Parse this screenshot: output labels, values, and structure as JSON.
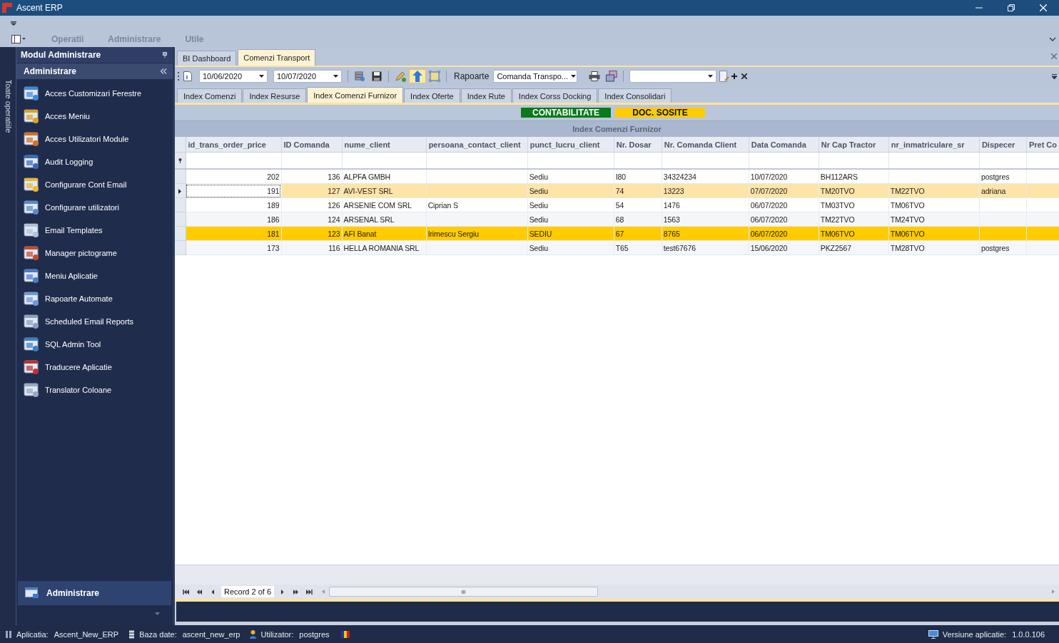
{
  "window": {
    "title": "Ascent ERP"
  },
  "menu": [
    {
      "label": "Operatii"
    },
    {
      "label": "Administrare"
    },
    {
      "label": "Utile"
    }
  ],
  "side_strip": {
    "label": "Toate operatiile"
  },
  "sidebar": {
    "title": "Modul Administrare",
    "group": "Administrare",
    "items": [
      {
        "label": "Acces Customizari Ferestre"
      },
      {
        "label": "Acces Meniu"
      },
      {
        "label": "Acces Utilizatori Module"
      },
      {
        "label": "Audit Logging"
      },
      {
        "label": "Configurare Cont Email"
      },
      {
        "label": "Configurare utilizatori"
      },
      {
        "label": "Email Templates"
      },
      {
        "label": "Manager pictograme"
      },
      {
        "label": "Meniu Aplicatie"
      },
      {
        "label": "Rapoarte Automate"
      },
      {
        "label": "Scheduled Email Reports"
      },
      {
        "label": "SQL Admin Tool"
      },
      {
        "label": "Traducere Aplicatie"
      },
      {
        "label": "Translator Coloane"
      }
    ],
    "footer_group": "Administrare"
  },
  "doc_tabs": [
    {
      "label": "BI Dashboard",
      "selected": false
    },
    {
      "label": "Comenzi Transport",
      "selected": true
    }
  ],
  "toolbar": {
    "date_from": "10/06/2020",
    "date_to": "10/07/2020",
    "reports_label": "Rapoarte",
    "report": "Comanda Transpo..."
  },
  "sub_tabs": [
    {
      "label": "Index Comenzi",
      "selected": false
    },
    {
      "label": "Index Resurse",
      "selected": false
    },
    {
      "label": "Index Comenzi Furnizor",
      "selected": true
    },
    {
      "label": "Index Oferte",
      "selected": false
    },
    {
      "label": "Index Rute",
      "selected": false
    },
    {
      "label": "Index Corss Docking",
      "selected": false
    },
    {
      "label": "Index Consolidari",
      "selected": false
    }
  ],
  "badges": [
    {
      "label": "CONTABILITATE",
      "color": "#0b7a1c"
    },
    {
      "label": "DOC. SOSITE",
      "color": "#ffcc00"
    }
  ],
  "grid": {
    "title": "Index Comenzi Furnizor",
    "columns": [
      {
        "label": "id_trans_order_price",
        "kind": "number"
      },
      {
        "label": "ID Comanda",
        "kind": "number"
      },
      {
        "label": "nume_client",
        "kind": "text"
      },
      {
        "label": "persoana_contact_client",
        "kind": "text"
      },
      {
        "label": "punct_lucru_client",
        "kind": "text"
      },
      {
        "label": "Nr. Dosar",
        "kind": "text"
      },
      {
        "label": "Nr. Comanda Client",
        "kind": "text"
      },
      {
        "label": "Data Comanda",
        "kind": "text"
      },
      {
        "label": "Nr Cap Tractor",
        "kind": "text"
      },
      {
        "label": "nr_inmatriculare_sr",
        "kind": "text"
      },
      {
        "label": "Dispecer",
        "kind": "text"
      },
      {
        "label": "Pret Co",
        "kind": "text"
      }
    ],
    "rows": [
      {
        "cells": [
          "202",
          "136",
          "ALPFA GMBH",
          null,
          "Sediu",
          "I80",
          "34324234",
          "10/07/2020",
          "BH112ARS",
          null,
          "postgres",
          null
        ],
        "selected": false,
        "highlighted": false
      },
      {
        "cells": [
          "191",
          "127",
          "AVI-VEST SRL",
          null,
          "Sediu",
          "74",
          "13223",
          "07/07/2020",
          "TM20TVO",
          "TM22TVO",
          "adriana",
          null
        ],
        "selected": true,
        "highlighted": false
      },
      {
        "cells": [
          "189",
          "126",
          "ARSENIE COM SRL",
          "Ciprian S",
          "Sediu",
          "54",
          "1476",
          "06/07/2020",
          "TM03TVO",
          "TM06TVO",
          null,
          null
        ],
        "selected": false,
        "highlighted": false
      },
      {
        "cells": [
          "186",
          "124",
          "ARSENAL SRL",
          null,
          "Sediu",
          "68",
          "1563",
          "06/07/2020",
          "TM22TVO",
          "TM24TVO",
          null,
          null
        ],
        "selected": false,
        "highlighted": false
      },
      {
        "cells": [
          "181",
          "123",
          "AFI Banat",
          "Irimescu Sergiu",
          "SEDIU",
          "67",
          "8765",
          "06/07/2020",
          "TM06TVO",
          "TM06TVO",
          null,
          null
        ],
        "selected": false,
        "highlighted": true
      },
      {
        "cells": [
          "173",
          "116",
          "HELLA ROMANIA SRL",
          null,
          "Sediu",
          "T65",
          "test67676",
          "15/06/2020",
          "PKZ2567",
          "TM28TVO",
          "postgres",
          null
        ],
        "selected": false,
        "highlighted": false
      }
    ]
  },
  "navigator": {
    "record": "Record 2 of 6"
  },
  "status_bar": {
    "items": [
      {
        "label": "Aplicatia:",
        "value": "Ascent_New_ERP"
      },
      {
        "label": "Baza date:",
        "value": "ascent_new_erp"
      },
      {
        "label": "Utilizator:",
        "value": "postgres"
      }
    ],
    "version_label": "Versiune aplicatie:",
    "version": "1.0.0.106"
  }
}
